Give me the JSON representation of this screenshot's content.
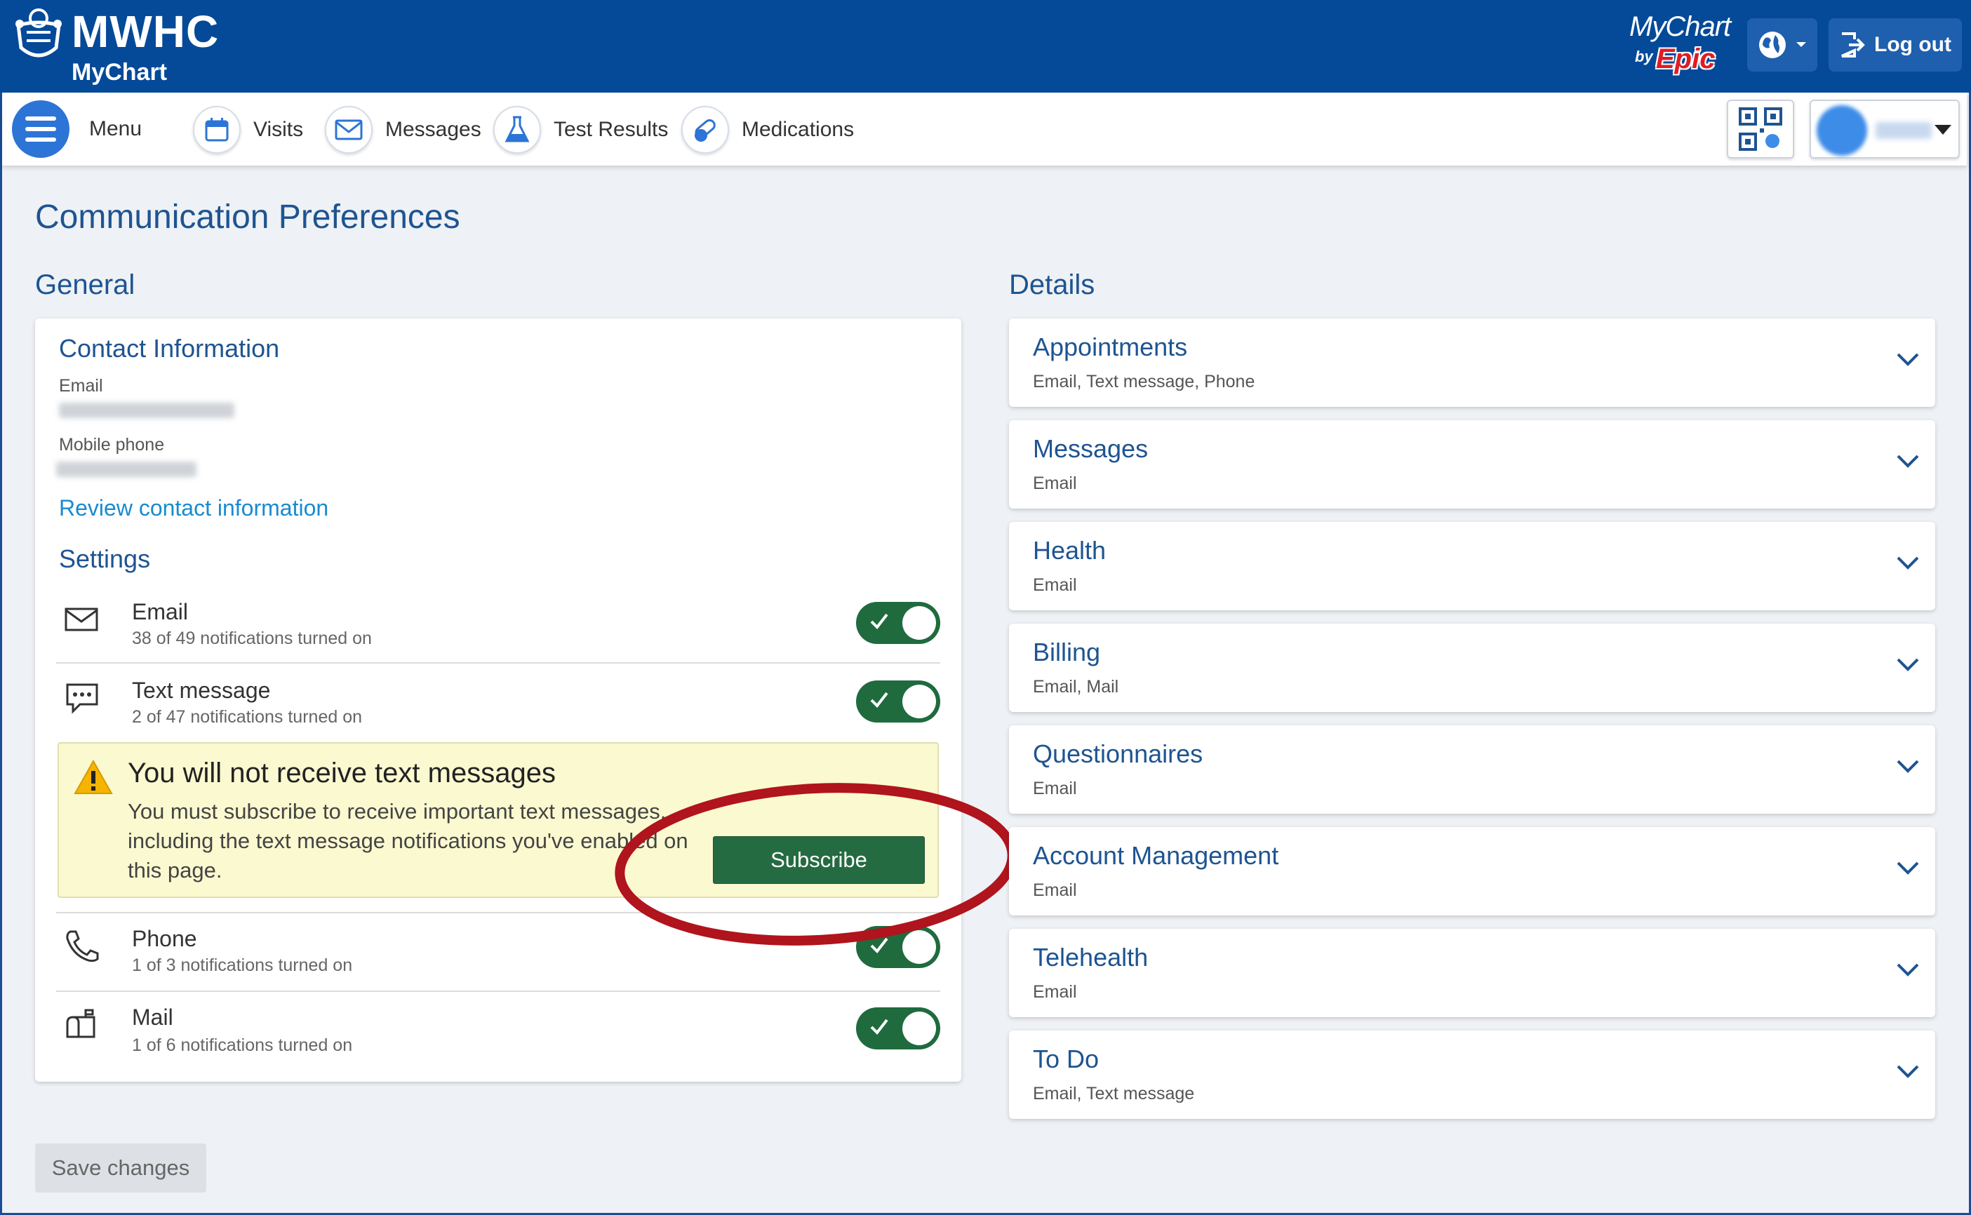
{
  "header": {
    "logo_main": "MWHC",
    "logo_sub": "MyChart",
    "brand_mychart": "MyChart",
    "brand_by": "by",
    "brand_epic": "Epic",
    "logout_label": "Log out"
  },
  "nav": {
    "menu_label": "Menu",
    "visits_label": "Visits",
    "messages_label": "Messages",
    "test_results_label": "Test Results",
    "medications_label": "Medications"
  },
  "page": {
    "title": "Communication Preferences",
    "general_title": "General",
    "details_title": "Details",
    "save_label": "Save changes"
  },
  "contact": {
    "heading": "Contact Information",
    "email_label": "Email",
    "mobile_label": "Mobile phone",
    "review_link": "Review contact information"
  },
  "settings": {
    "heading": "Settings",
    "rows": [
      {
        "name": "Email",
        "sub": "38 of 49 notifications turned on",
        "enabled": true
      },
      {
        "name": "Text message",
        "sub": "2 of 47 notifications turned on",
        "enabled": true
      },
      {
        "name": "Phone",
        "sub": "1 of 3 notifications turned on",
        "enabled": true
      },
      {
        "name": "Mail",
        "sub": "1 of 6 notifications turned on",
        "enabled": true
      }
    ]
  },
  "warning": {
    "title": "You will not receive text messages",
    "text": "You must subscribe to receive important text messages, including the text message notifications you've enabled on this page.",
    "button": "Subscribe"
  },
  "details": [
    {
      "title": "Appointments",
      "sub": "Email, Text message, Phone"
    },
    {
      "title": "Messages",
      "sub": "Email"
    },
    {
      "title": "Health",
      "sub": "Email"
    },
    {
      "title": "Billing",
      "sub": "Email, Mail"
    },
    {
      "title": "Questionnaires",
      "sub": "Email"
    },
    {
      "title": "Account Management",
      "sub": "Email"
    },
    {
      "title": "Telehealth",
      "sub": "Email"
    },
    {
      "title": "To Do",
      "sub": "Email, Text message"
    }
  ],
  "colors": {
    "header_bg": "#044a98",
    "accent_blue": "#1e5491",
    "toggle_on": "#1f6b3e",
    "subscribe_bg": "#256b42",
    "warning_bg": "#fbf9d0",
    "annotation_ring": "#b0141c"
  }
}
